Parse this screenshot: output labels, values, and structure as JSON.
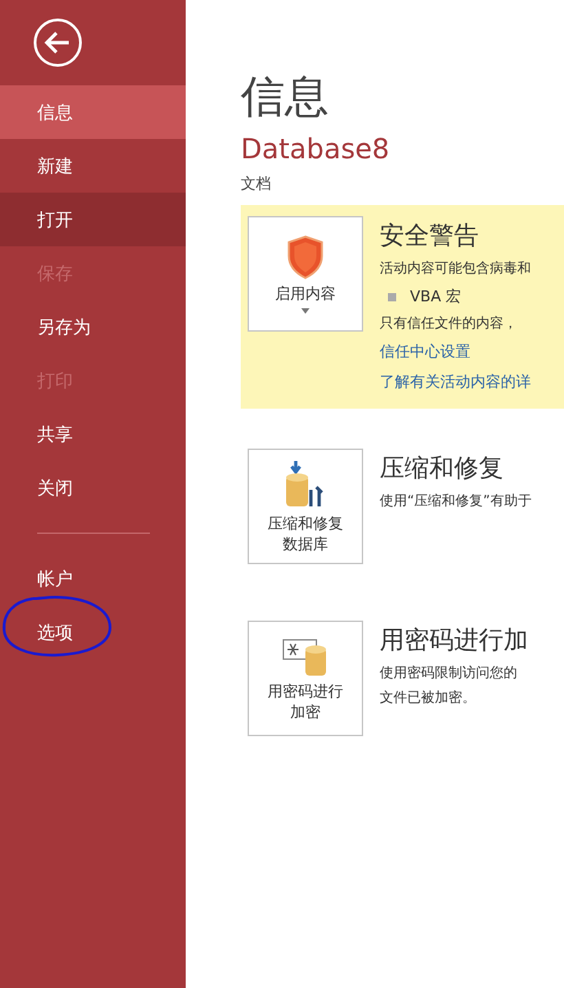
{
  "sidebar": {
    "items": [
      {
        "label": "信息",
        "selected": true,
        "hovered": false,
        "disabled": false
      },
      {
        "label": "新建",
        "selected": false,
        "hovered": false,
        "disabled": false
      },
      {
        "label": "打开",
        "selected": false,
        "hovered": true,
        "disabled": false
      },
      {
        "label": "保存",
        "selected": false,
        "hovered": false,
        "disabled": true
      },
      {
        "label": "另存为",
        "selected": false,
        "hovered": false,
        "disabled": false
      },
      {
        "label": "打印",
        "selected": false,
        "hovered": false,
        "disabled": true
      },
      {
        "label": "共享",
        "selected": false,
        "hovered": false,
        "disabled": false
      },
      {
        "label": "关闭",
        "selected": false,
        "hovered": false,
        "disabled": false
      }
    ],
    "footer_items": [
      {
        "label": "帐户",
        "selected": false
      },
      {
        "label": "选项",
        "selected": false
      }
    ]
  },
  "page": {
    "title": "信息",
    "database_name": "Database8",
    "location": "文档"
  },
  "sections": [
    {
      "kind": "warning",
      "button_label": "启用内容",
      "title": "安全警告",
      "description": "活动内容可能包含病毒和",
      "bullet": "VBA 宏",
      "note": "只有信任文件的内容，",
      "links": [
        "信任中心设置",
        "了解有关活动内容的详"
      ]
    },
    {
      "kind": "compact",
      "button_label": "压缩和修复数据库",
      "title": "压缩和修复",
      "description": "使用“压缩和修复”有助于"
    },
    {
      "kind": "encrypt",
      "button_label": "用密码进行加密",
      "title": "用密码进行加",
      "description": "使用密码限制访问您的",
      "description_2": "文件已被加密。"
    }
  ]
}
